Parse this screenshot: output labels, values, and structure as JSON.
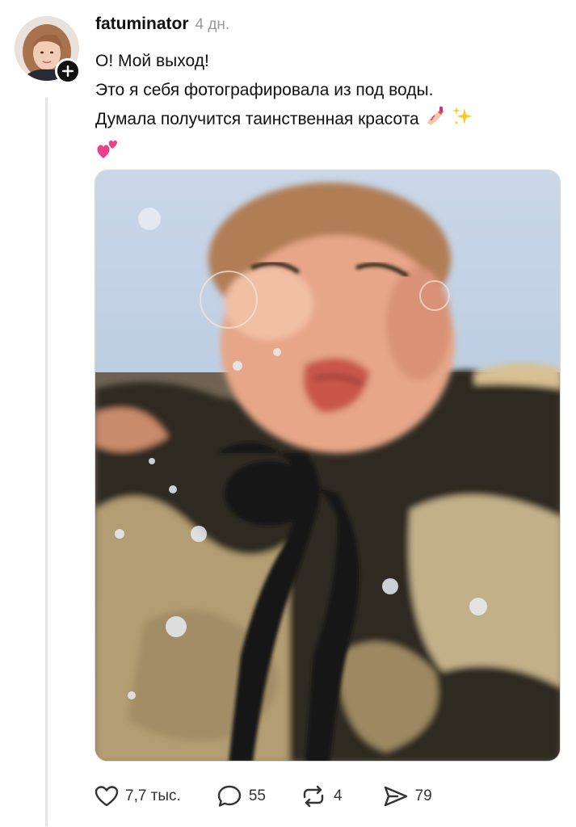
{
  "post": {
    "username": "fatuminator",
    "timestamp": "4 дн.",
    "lines": [
      "О! Мой выход!",
      "Это я себя фотографировала из под воды.",
      "Думала получится таинственная красота"
    ],
    "emojis": [
      "nail-polish-emoji",
      "sparkles-emoji",
      "two-hearts-emoji"
    ]
  },
  "actions": {
    "likes": "7,7 тыс.",
    "comments": "55",
    "reposts": "4",
    "shares": "79"
  },
  "icons": {
    "like": "heart-icon",
    "comment": "speech-bubble-icon",
    "repost": "repost-arrows-icon",
    "share": "send-icon",
    "follow": "plus-icon"
  },
  "colors": {
    "text": "#111111",
    "muted": "#9a9a9a",
    "icon": "#333333",
    "thread_line": "#e6e6e6"
  }
}
